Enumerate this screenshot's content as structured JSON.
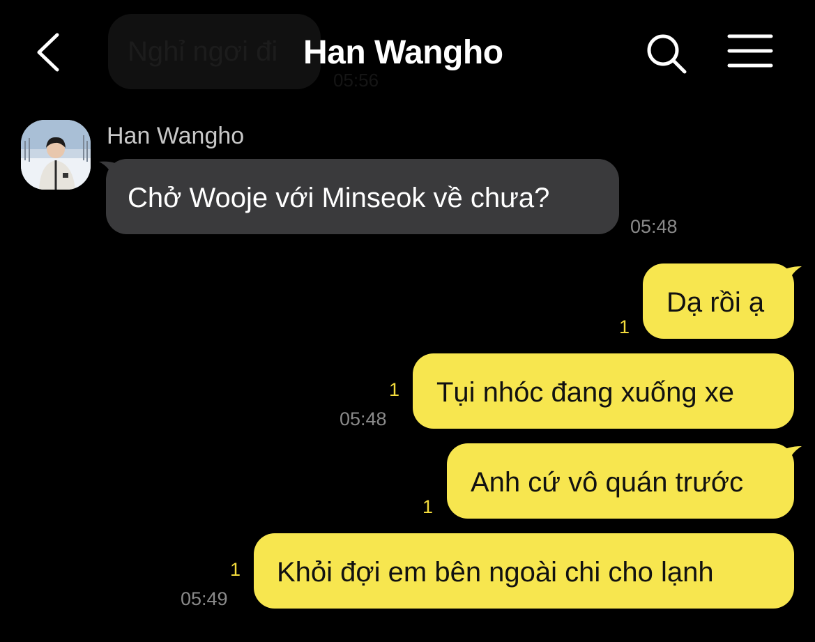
{
  "header": {
    "title": "Han Wangho"
  },
  "previous_message": {
    "text": "Nghỉ ngơi đi",
    "time": "05:56"
  },
  "messages": [
    {
      "direction": "in",
      "sender": "Han Wangho",
      "text": "Chở Wooje với Minseok về chưa?",
      "time": "05:48"
    },
    {
      "direction": "out",
      "text": "Dạ rồi ạ",
      "unread": "1"
    },
    {
      "direction": "out",
      "text": "Tụi nhóc đang xuống xe",
      "unread": "1",
      "time": "05:48"
    },
    {
      "direction": "out",
      "text": "Anh cứ vô quán trước",
      "unread": "1"
    },
    {
      "direction": "out",
      "text": "Khỏi đợi em bên ngoài chi cho lạnh",
      "unread": "1",
      "time": "05:49"
    }
  ],
  "colors": {
    "background": "#000000",
    "incoming_bubble": "#3a3a3c",
    "outgoing_bubble": "#f7e64f",
    "unread_count": "#f4dc3c",
    "timestamp": "#8a8a8a"
  },
  "icons": {
    "back": "chevron-left-icon",
    "search": "search-icon",
    "menu": "hamburger-menu-icon"
  }
}
